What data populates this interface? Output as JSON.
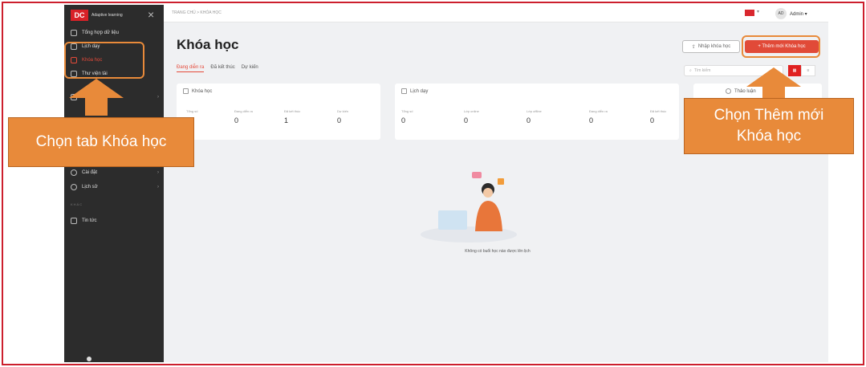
{
  "app": {
    "logo_text": "Adaptive learning",
    "breadcrumb": "TRANG CHỦ > KHÓA HỌC",
    "language_flag": "vi-flag-icon",
    "user_initials": "AD",
    "user_name": "Admin"
  },
  "sidebar": {
    "items": [
      {
        "label": "Tổng hợp dữ liệu",
        "icon": "dashboard-icon"
      },
      {
        "label": "Lịch dạy",
        "icon": "calendar-icon"
      },
      {
        "label": "Khóa học",
        "icon": "book-icon"
      },
      {
        "label": "Thư viện tài",
        "icon": "library-icon"
      },
      {
        "label": "",
        "icon": "chat-icon"
      },
      {
        "label": "Cài đặt",
        "icon": "gear-icon"
      },
      {
        "label": "Lịch sử",
        "icon": "history-icon"
      }
    ],
    "section_label": "KHÁC",
    "news_label": "Tin tức"
  },
  "main": {
    "title": "Khóa học",
    "tabs": [
      "Đang diễn ra",
      "Đã kết thúc",
      "Dự kiến"
    ],
    "active_tab": 0,
    "import_button": "Nhập khóa học",
    "add_button": "+ Thêm mới Khóa học",
    "search_placeholder": "Tìm kiếm",
    "view_toggle": [
      "",
      ""
    ],
    "cards": {
      "courses": {
        "title": "Khóa học",
        "stats": [
          {
            "label": "Tổng số",
            "value": ""
          },
          {
            "label": "Đang diễn ra",
            "value": "0"
          },
          {
            "label": "Đã kết thúc",
            "value": "1"
          },
          {
            "label": "Dự kiến",
            "value": "0"
          }
        ]
      },
      "schedule": {
        "title": "Lịch dạy",
        "stats": [
          {
            "label": "Tổng số",
            "value": "0"
          },
          {
            "label": "Lớp online",
            "value": "0"
          },
          {
            "label": "Lớp offline",
            "value": "0"
          },
          {
            "label": "Đang diễn ra",
            "value": "0"
          },
          {
            "label": "Đã kết thúc",
            "value": "0"
          }
        ]
      },
      "discussion": {
        "title": "Thảo luận"
      }
    },
    "empty_message": "Không có buổi học nào được lên lịch"
  },
  "annotations": {
    "left_callout": "Chọn tab Khóa học",
    "right_callout_line1": "Chọn Thêm mới",
    "right_callout_line2": "Khóa học"
  },
  "colors": {
    "accent": "#e14a38",
    "callout": "#e88a3a",
    "sidebar": "#2c2c2c",
    "frame": "#cc1f2d"
  }
}
